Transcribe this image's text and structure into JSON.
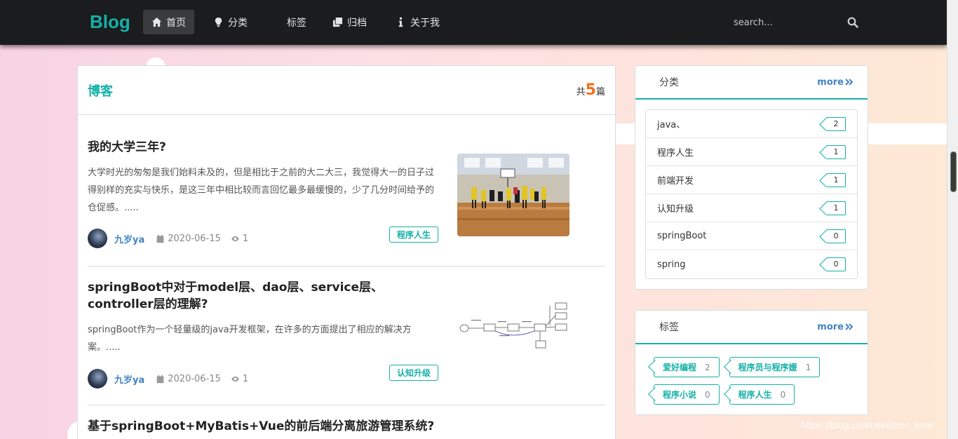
{
  "nav": {
    "brand": "Blog",
    "items": [
      {
        "label": "首页",
        "icon": "home-icon",
        "active": true
      },
      {
        "label": "分类",
        "icon": "lightbulb-icon"
      },
      {
        "label": "标签",
        "icon": "tag-icon"
      },
      {
        "label": "归档",
        "icon": "clone-icon"
      },
      {
        "label": "关于我",
        "icon": "info-icon"
      }
    ],
    "search_placeholder": "search..."
  },
  "main": {
    "title": "博客",
    "count_prefix": "共",
    "count": "5",
    "count_suffix": "篇",
    "posts": [
      {
        "title": "我的大学三年?",
        "excerpt": "大学时光的匆匆是我们始料未及的，但是相比于之前的大二大三，我觉得大一的日子过得别样的充实与快乐，是这三年中相比较而言回忆最多最缓慢的，少了几分时间给予的仓促感。.....",
        "author": "九岁ya",
        "date": "2020-06-15",
        "views": "1",
        "tag": "程序人生",
        "thumb": "basketball-court-photo"
      },
      {
        "title": "springBoot中对于model层、dao层、service层、controller层的理解?",
        "excerpt": "springBoot作为一个轻量级的java开发框架，在许多的方面提出了相应的解决方案。.....",
        "author": "九岁ya",
        "date": "2020-06-15",
        "views": "1",
        "tag": "认知升级",
        "thumb": "architecture-diagram"
      },
      {
        "title": "基于springBoot+MyBatis+Vue的前后端分离旅游管理系统?"
      }
    ]
  },
  "categories": {
    "title": "分类",
    "more": "more",
    "items": [
      {
        "name": "java、",
        "count": "2"
      },
      {
        "name": "程序人生",
        "count": "1"
      },
      {
        "name": "前端开发",
        "count": "1"
      },
      {
        "name": "认知升级",
        "count": "1"
      },
      {
        "name": "springBoot",
        "count": "0"
      },
      {
        "name": "spring",
        "count": "0"
      }
    ]
  },
  "tags": {
    "title": "标签",
    "more": "more",
    "items": [
      {
        "name": "爱好编程",
        "count": "2"
      },
      {
        "name": "程序员与程序媛",
        "count": "1"
      },
      {
        "name": "程序小说",
        "count": "0"
      },
      {
        "name": "程序人生",
        "count": "0"
      }
    ]
  },
  "watermark": "https://blog.csdn.net/mzc_love",
  "colors": {
    "accent": "#14b1a8",
    "link": "#4183c4",
    "count": "#f2711c",
    "nav_bg": "#1b1c1d"
  }
}
